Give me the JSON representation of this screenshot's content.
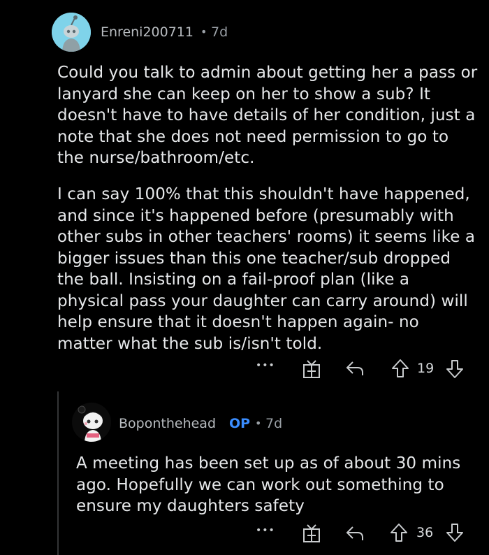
{
  "comments": [
    {
      "username": "Enreni200711",
      "time": "7d",
      "paragraphs": [
        [
          "Could you talk to admin about getting her a pass or",
          "lanyard she can keep on her to show a sub? It",
          "doesn't have to have details of her condition, just a",
          "note that she does not need permission to go to",
          "the nurse/bathroom/etc."
        ],
        [
          "I can say 100% that this shouldn't have happened,",
          "and since it's happened before (presumably with",
          "other subs in other teachers' rooms) it seems like a",
          "bigger issues than this one teacher/sub dropped",
          "the ball. Insisting on a fail-proof plan (like a",
          "physical pass your daughter can carry around) will",
          "help ensure that it doesn't happen again- no",
          "matter what the sub is/isn't told."
        ]
      ],
      "votes": "19",
      "icons": [
        "more-icon",
        "award-icon",
        "reply-icon",
        "upvote-icon",
        "downvote-icon"
      ]
    },
    {
      "username": "Boponthehead",
      "op_label": "OP",
      "time": "7d",
      "paragraphs": [
        [
          "A meeting has been set up as of about 30 mins",
          "ago. Hopefully we can work out something to",
          "ensure my daughters safety"
        ]
      ],
      "votes": "36",
      "icons": [
        "more-icon",
        "award-icon",
        "reply-icon",
        "upvote-icon",
        "downvote-icon"
      ]
    }
  ],
  "separator": "•",
  "more_glyph": "•••",
  "colors": {
    "background": "#000000",
    "text": "#e6e8ea",
    "meta": "#9aa0a6",
    "op": "#3a8dff",
    "avatar1_bg": "#7fd3ea"
  }
}
